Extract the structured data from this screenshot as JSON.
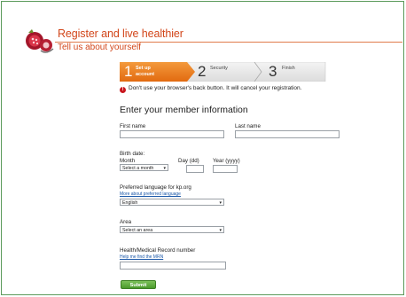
{
  "header": {
    "title": "Register and live healthier",
    "subtitle": "Tell us about yourself"
  },
  "steps": [
    {
      "number": "1",
      "label_line1": "Set up",
      "label_line2": "account",
      "active": true
    },
    {
      "number": "2",
      "label_line1": "Security",
      "label_line2": "",
      "active": false
    },
    {
      "number": "3",
      "label_line1": "Finish",
      "label_line2": "",
      "active": false
    }
  ],
  "warning": "Don't use your browser's back button. It will cancel your registration.",
  "form": {
    "heading": "Enter your member information",
    "first_name_label": "First name",
    "last_name_label": "Last name",
    "birth_date_label": "Birth date:",
    "month_label": "Month",
    "month_value": "Select a month",
    "day_label": "Day (dd)",
    "year_label": "Year (yyyy)",
    "language_label": "Preferred language for kp.org",
    "language_link": "More about preferred language",
    "language_value": "English",
    "area_label": "Area",
    "area_value": "Select an area",
    "mrn_label": "Health/Medical Record number",
    "mrn_link": "Help me find the MRN",
    "submit_label": "Submit"
  },
  "colors": {
    "accent_orange": "#e8741a",
    "title_orange": "#d2461a",
    "link_blue": "#1a57a8",
    "submit_green": "#5aaa38",
    "frame_green": "#5b9a5b"
  }
}
